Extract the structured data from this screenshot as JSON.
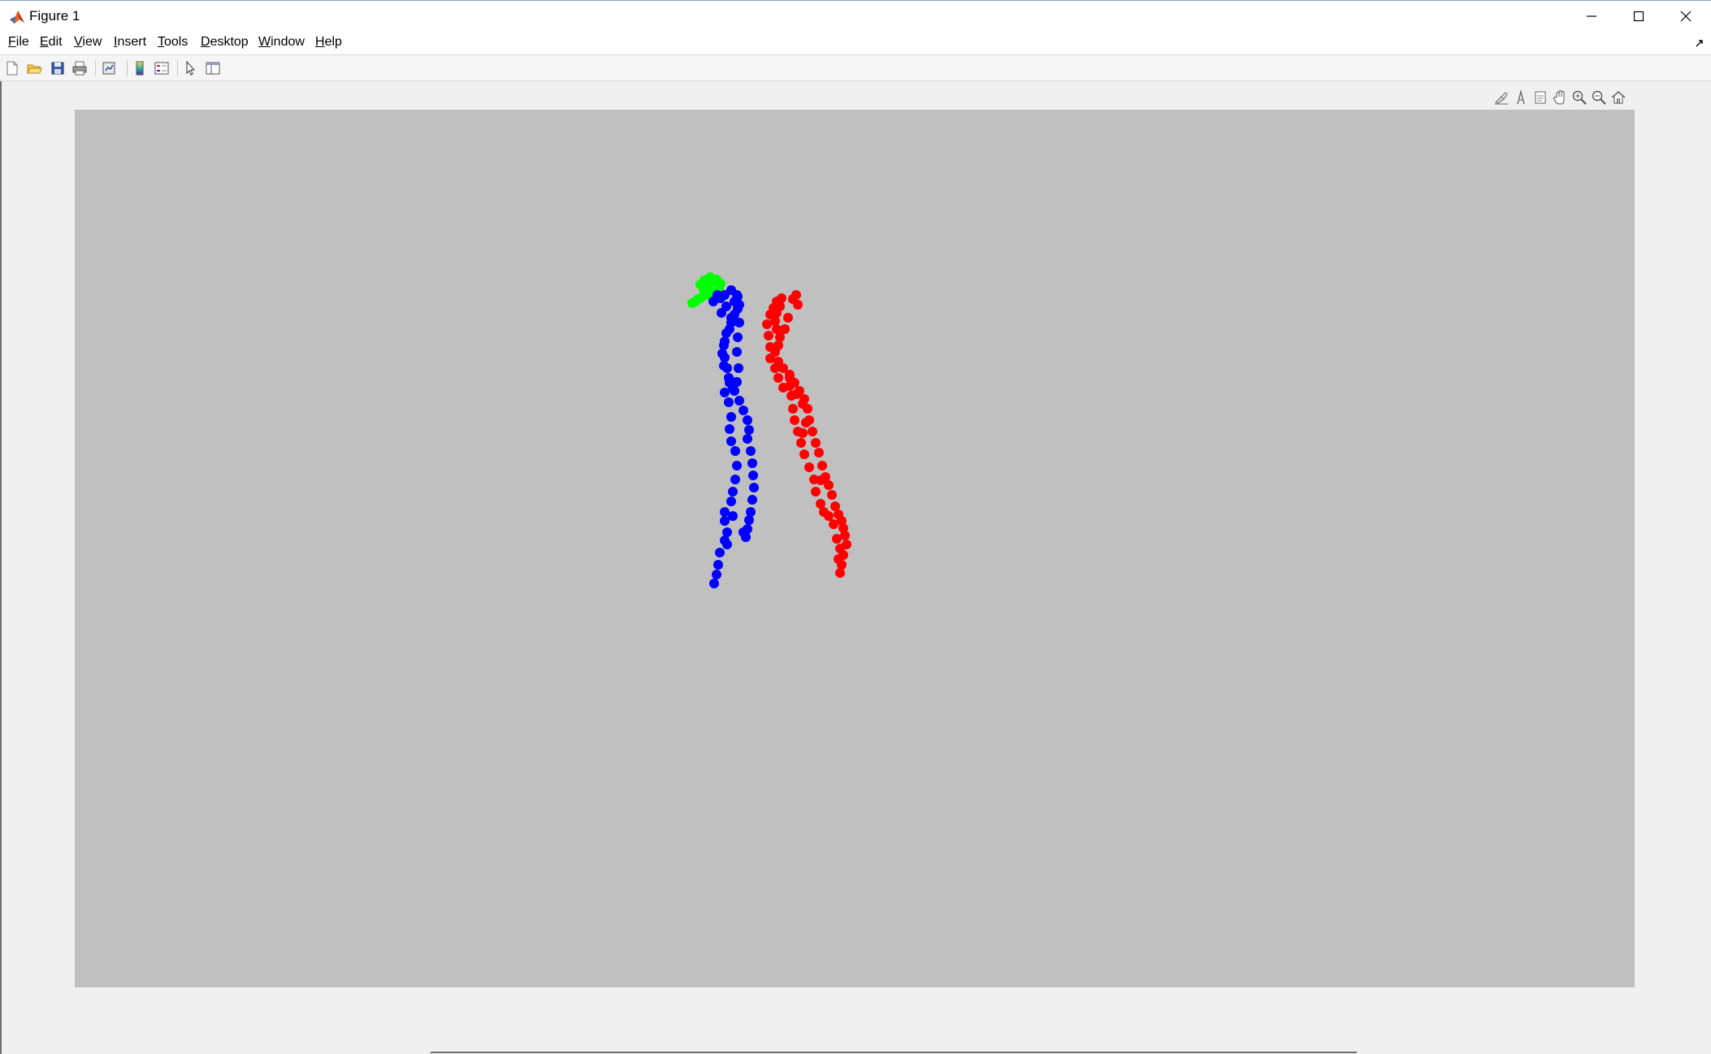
{
  "window": {
    "title": "Figure 1",
    "controls": [
      "minimize",
      "maximize",
      "close"
    ]
  },
  "menu": {
    "items": [
      {
        "label": "File",
        "u": "F",
        "rest": "ile"
      },
      {
        "label": "Edit",
        "u": "E",
        "rest": "dit"
      },
      {
        "label": "View",
        "u": "V",
        "rest": "iew"
      },
      {
        "label": "Insert",
        "u": "I",
        "rest": "nsert"
      },
      {
        "label": "Tools",
        "u": "T",
        "rest": "ools"
      },
      {
        "label": "Desktop",
        "u": "D",
        "rest": "esktop"
      },
      {
        "label": "Window",
        "u": "W",
        "rest": "indow"
      },
      {
        "label": "Help",
        "u": "H",
        "rest": "elp"
      }
    ]
  },
  "toolbar": {
    "icons": [
      "new-figure-icon",
      "open-file-icon",
      "save-icon",
      "print-icon",
      "link-plot-icon",
      "insert-colorbar-icon",
      "insert-legend-icon",
      "edit-plot-icon",
      "property-inspector-icon"
    ]
  },
  "axes_toolbar": {
    "icons": [
      "brush-icon",
      "data-tips-icon",
      "export-icon",
      "pan-icon",
      "zoom-in-icon",
      "zoom-out-icon",
      "restore-view-icon"
    ]
  },
  "colors": {
    "axes_background": "#c0c0c0",
    "green": "#00ff00",
    "blue": "#0000ff",
    "red": "#ff0000"
  },
  "chart_data": {
    "type": "scatter",
    "grid": false,
    "xlim": [
      0,
      1920
    ],
    "ylim": [
      1080,
      0
    ],
    "series": [
      {
        "color": "#00ff00",
        "points": [
          [
            770,
            215
          ],
          [
            775,
            210
          ],
          [
            782,
            206
          ],
          [
            790,
            209
          ],
          [
            795,
            214
          ],
          [
            793,
            220
          ],
          [
            786,
            225
          ],
          [
            778,
            228
          ],
          [
            770,
            232
          ],
          [
            764,
            236
          ],
          [
            760,
            238
          ],
          [
            767,
            233
          ],
          [
            774,
            222
          ],
          [
            780,
            216
          ],
          [
            788,
            212
          ]
        ]
      },
      {
        "color": "#0000ff",
        "points": [
          [
            800,
            228
          ],
          [
            808,
            222
          ],
          [
            815,
            228
          ],
          [
            818,
            240
          ],
          [
            812,
            252
          ],
          [
            808,
            262
          ],
          [
            802,
            275
          ],
          [
            799,
            290
          ],
          [
            800,
            305
          ],
          [
            803,
            318
          ],
          [
            806,
            332
          ],
          [
            812,
            346
          ],
          [
            818,
            358
          ],
          [
            823,
            370
          ],
          [
            828,
            382
          ],
          [
            830,
            394
          ],
          [
            828,
            405
          ],
          [
            832,
            420
          ],
          [
            834,
            435
          ],
          [
            835,
            450
          ],
          [
            836,
            465
          ],
          [
            834,
            480
          ],
          [
            832,
            495
          ],
          [
            830,
            505
          ],
          [
            828,
            516
          ],
          [
            826,
            526
          ],
          [
            823,
            520
          ],
          [
            816,
            230
          ],
          [
            816,
            245
          ],
          [
            818,
            262
          ],
          [
            816,
            280
          ],
          [
            815,
            298
          ],
          [
            817,
            318
          ],
          [
            815,
            335
          ],
          [
            810,
            342
          ],
          [
            805,
            330
          ],
          [
            799,
            315
          ],
          [
            797,
            300
          ],
          [
            800,
            285
          ],
          [
            806,
            270
          ],
          [
            808,
            256
          ],
          [
            802,
            242
          ],
          [
            795,
            232
          ],
          [
            791,
            228
          ],
          [
            786,
            236
          ],
          [
            796,
            250
          ],
          [
            812,
            236
          ],
          [
            806,
            336
          ],
          [
            800,
            348
          ],
          [
            805,
            360
          ],
          [
            808,
            378
          ],
          [
            806,
            393
          ],
          [
            808,
            408
          ],
          [
            813,
            420
          ],
          [
            815,
            438
          ],
          [
            813,
            455
          ],
          [
            810,
            470
          ],
          [
            808,
            482
          ],
          [
            800,
            495
          ],
          [
            800,
            506
          ],
          [
            803,
            520
          ],
          [
            800,
            530
          ],
          [
            794,
            545
          ],
          [
            792,
            560
          ],
          [
            790,
            572
          ],
          [
            787,
            583
          ],
          [
            810,
            500
          ],
          [
            803,
            535
          ]
        ]
      },
      {
        "color": "#ff0000",
        "points": [
          [
            870,
            232
          ],
          [
            868,
            242
          ],
          [
            864,
            250
          ],
          [
            862,
            260
          ],
          [
            864,
            270
          ],
          [
            868,
            280
          ],
          [
            866,
            290
          ],
          [
            862,
            298
          ],
          [
            866,
            310
          ],
          [
            872,
            318
          ],
          [
            880,
            326
          ],
          [
            886,
            336
          ],
          [
            892,
            346
          ],
          [
            898,
            356
          ],
          [
            902,
            368
          ],
          [
            904,
            382
          ],
          [
            908,
            396
          ],
          [
            912,
            410
          ],
          [
            916,
            422
          ],
          [
            920,
            438
          ],
          [
            924,
            452
          ],
          [
            928,
            462
          ],
          [
            932,
            474
          ],
          [
            936,
            488
          ],
          [
            940,
            498
          ],
          [
            944,
            506
          ],
          [
            946,
            515
          ],
          [
            948,
            524
          ],
          [
            950,
            535
          ],
          [
            946,
            548
          ],
          [
            944,
            560
          ],
          [
            942,
            570
          ],
          [
            938,
            528
          ],
          [
            934,
            510
          ],
          [
            928,
            500
          ],
          [
            922,
            495
          ],
          [
            918,
            485
          ],
          [
            912,
            470
          ],
          [
            910,
            455
          ],
          [
            904,
            440
          ],
          [
            898,
            424
          ],
          [
            894,
            410
          ],
          [
            890,
            396
          ],
          [
            886,
            382
          ],
          [
            884,
            368
          ],
          [
            882,
            352
          ],
          [
            872,
            342
          ],
          [
            866,
            330
          ],
          [
            862,
            318
          ],
          [
            856,
            306
          ],
          [
            856,
            292
          ],
          [
            854,
            278
          ],
          [
            852,
            264
          ],
          [
            856,
            252
          ],
          [
            860,
            244
          ],
          [
            864,
            236
          ],
          [
            880,
            340
          ],
          [
            888,
            350
          ],
          [
            896,
            362
          ],
          [
            884,
            233
          ],
          [
            890,
            240
          ],
          [
            888,
            228
          ],
          [
            874,
            270
          ],
          [
            878,
            256
          ],
          [
            880,
            330
          ],
          [
            900,
            385
          ],
          [
            896,
            398
          ],
          [
            918,
            456
          ],
          [
            942,
            540
          ],
          [
            940,
            553
          ]
        ]
      }
    ]
  }
}
